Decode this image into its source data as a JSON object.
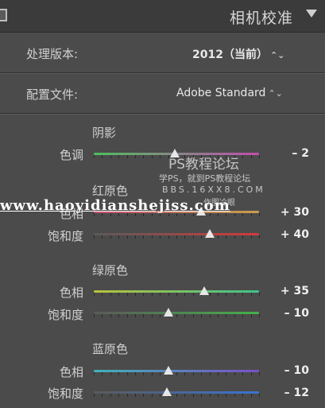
{
  "header": {
    "title": "相机校准"
  },
  "rows": [
    {
      "label": "处理版本:",
      "value": "2012（当前）"
    },
    {
      "label": "配置文件:",
      "value": "Adobe Standard"
    }
  ],
  "sections": [
    {
      "title": "阴影",
      "sliders": [
        {
          "label": "色调",
          "value": "– 2",
          "position": 0.49,
          "colors": [
            "#4fbf5e",
            "#c04fae"
          ]
        }
      ]
    },
    {
      "title": "红原色",
      "sliders": [
        {
          "label": "色相",
          "value": "+ 30",
          "position": 0.65,
          "colors": [
            "#c24f74",
            "#c7a04c"
          ]
        },
        {
          "label": "饱和度",
          "value": "+ 40",
          "position": 0.7,
          "colors": [
            "#5a5a5a",
            "#d23a3a"
          ]
        }
      ]
    },
    {
      "title": "绿原色",
      "sliders": [
        {
          "label": "色相",
          "value": "+ 35",
          "position": 0.67,
          "colors": [
            "#b8c23b",
            "#3fc28a"
          ]
        },
        {
          "label": "饱和度",
          "value": "– 10",
          "position": 0.45,
          "colors": [
            "#5a5a5a",
            "#45b04a"
          ]
        }
      ]
    },
    {
      "title": "蓝原色",
      "sliders": [
        {
          "label": "色相",
          "value": "– 10",
          "position": 0.45,
          "colors": [
            "#3fb3b9",
            "#7a4fc7"
          ]
        },
        {
          "label": "饱和度",
          "value": "– 12",
          "position": 0.44,
          "colors": [
            "#5a5a5a",
            "#3a73d2"
          ]
        }
      ]
    }
  ],
  "watermark": {
    "line1": "PS教程论坛",
    "line2": "学PS，就到PS教程论坛",
    "line3": "BBS.16XX8.COM",
    "line4": "作图冷眼",
    "url": "www.haoyidianshejiss.com"
  }
}
